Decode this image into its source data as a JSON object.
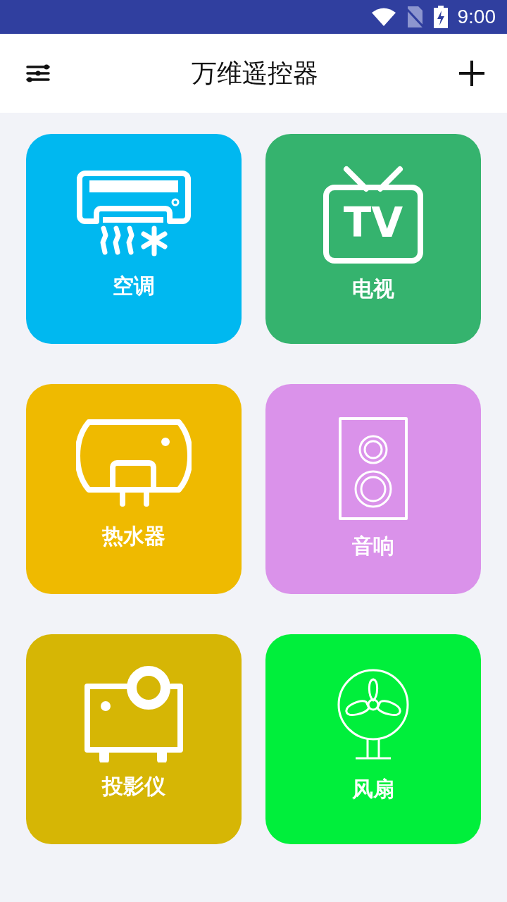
{
  "status_bar": {
    "time": "9:00"
  },
  "app_bar": {
    "title": "万维遥控器"
  },
  "tv_icon": {
    "text": "TV"
  },
  "devices": [
    {
      "kind": "ac",
      "label": "空调",
      "color": "#00b8f0"
    },
    {
      "kind": "tv",
      "label": "电视",
      "color": "#35b36e"
    },
    {
      "kind": "heater",
      "label": "热水器",
      "color": "#efba00"
    },
    {
      "kind": "speaker",
      "label": "音响",
      "color": "#da92ea"
    },
    {
      "kind": "projector",
      "label": "投影仪",
      "color": "#d6b605"
    },
    {
      "kind": "fan",
      "label": "风扇",
      "color": "#00ef3b"
    }
  ]
}
